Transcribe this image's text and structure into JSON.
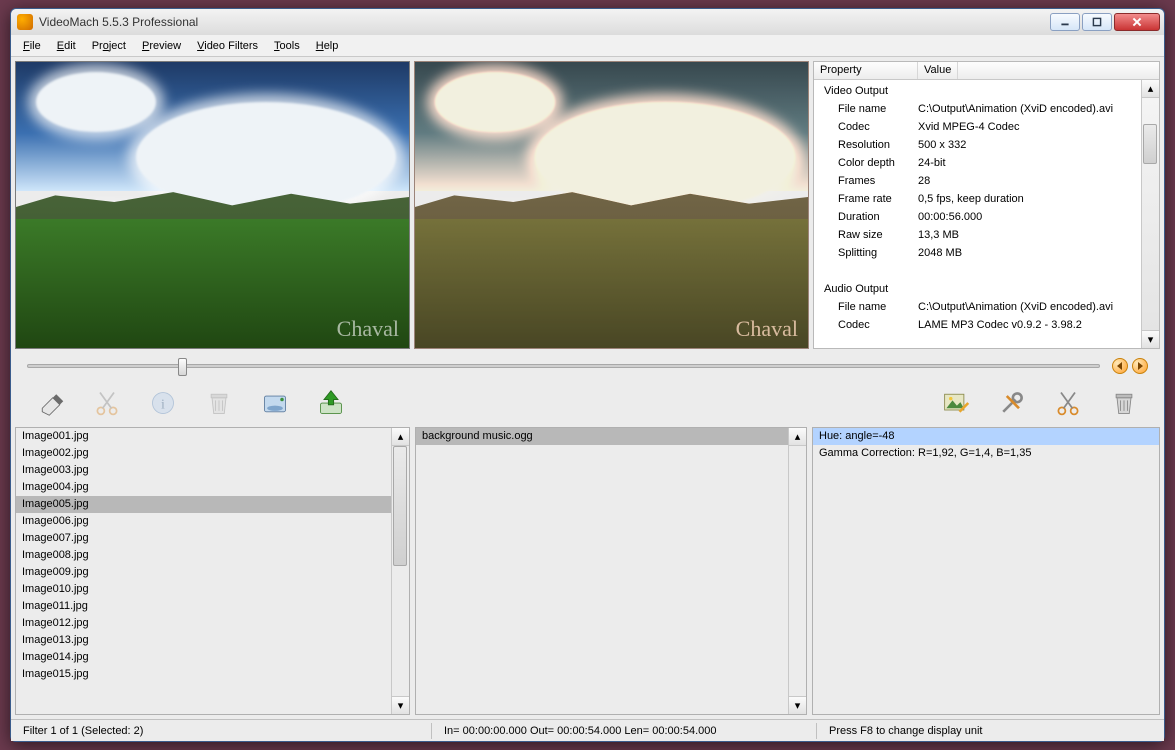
{
  "window": {
    "title": "VideoMach 5.5.3 Professional"
  },
  "menu": {
    "file": "File",
    "edit": "Edit",
    "project": "Project",
    "preview": "Preview",
    "filters": "Video Filters",
    "tools": "Tools",
    "help": "Help"
  },
  "watermark": "Chaval",
  "props": {
    "header": {
      "property": "Property",
      "value": "Value"
    },
    "sections": [
      {
        "title": "Video Output",
        "rows": [
          {
            "k": "File name",
            "v": "C:\\Output\\Animation (XviD encoded).avi"
          },
          {
            "k": "Codec",
            "v": "Xvid MPEG-4 Codec"
          },
          {
            "k": "Resolution",
            "v": "500 x 332"
          },
          {
            "k": "Color depth",
            "v": "24-bit"
          },
          {
            "k": "Frames",
            "v": "28"
          },
          {
            "k": "Frame rate",
            "v": "0,5 fps, keep duration"
          },
          {
            "k": "Duration",
            "v": "00:00:56.000"
          },
          {
            "k": "Raw size",
            "v": "13,3 MB"
          },
          {
            "k": "Splitting",
            "v": "2048 MB"
          }
        ]
      },
      {
        "title": "Audio Output",
        "rows": [
          {
            "k": "File name",
            "v": "C:\\Output\\Animation (XviD encoded).avi"
          },
          {
            "k": "Codec",
            "v": "LAME MP3 Codec v0.9.2 - 3.98.2"
          }
        ]
      }
    ]
  },
  "file_list": {
    "items": [
      "Image001.jpg",
      "Image002.jpg",
      "Image003.jpg",
      "Image004.jpg",
      "Image005.jpg",
      "Image006.jpg",
      "Image007.jpg",
      "Image008.jpg",
      "Image009.jpg",
      "Image010.jpg",
      "Image011.jpg",
      "Image012.jpg",
      "Image013.jpg",
      "Image014.jpg",
      "Image015.jpg"
    ],
    "selected_index": 4
  },
  "audio_list": {
    "items": [
      "background music.ogg"
    ],
    "selected_index": 0
  },
  "filter_list": {
    "items": [
      "Hue:  angle=-48",
      "Gamma Correction:  R=1,92, G=1,4, B=1,35"
    ],
    "highlight_index": 0
  },
  "status": {
    "left": "Filter 1 of 1  (Selected: 2)",
    "mid": "In= 00:00:00.000      Out= 00:00:54.000      Len= 00:00:54.000",
    "right": "Press F8 to change display unit"
  }
}
